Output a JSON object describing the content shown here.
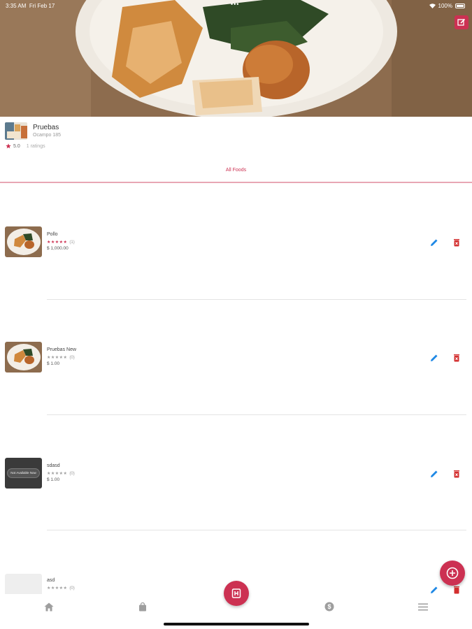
{
  "status_bar": {
    "time": "3:35 AM",
    "date": "Fri Feb 17",
    "dots": "•••",
    "battery": "100%"
  },
  "restaurant": {
    "name": "Pruebas",
    "address": "Ocampo 185",
    "rating": "5.0",
    "rating_count": "1 ratings"
  },
  "tabs": [
    {
      "label": "All Foods",
      "active": true
    }
  ],
  "foods": [
    {
      "name": "Pollo",
      "rating_count": "(1)",
      "price": "$ 1,000.00",
      "rated": true,
      "image": "food-photo"
    },
    {
      "name": "Pruebas New",
      "rating_count": "(0)",
      "price": "$ 1.00",
      "rated": false,
      "image": "food-photo"
    },
    {
      "name": "sdasd",
      "rating_count": "(0)",
      "price": "$ 1.00",
      "rated": false,
      "image": "not-available",
      "image_text": "Not Available Now"
    },
    {
      "name": "asd",
      "rating_count": "(0)",
      "price": "",
      "rated": false,
      "image": "empty"
    }
  ],
  "colors": {
    "accent": "#cc3152",
    "edit_icon": "#1e88e5",
    "delete_icon": "#d32f2f",
    "nav_icon": "#9e9e9e"
  },
  "icons": {
    "hero_edit": "edit-square-icon",
    "item_edit": "pencil-icon",
    "item_delete": "trash-icon",
    "fab": "add-circle-icon",
    "nav": [
      "home-icon",
      "orders-bag-icon",
      "restaurant-menu-icon",
      "dollar-icon",
      "menu-icon"
    ]
  }
}
